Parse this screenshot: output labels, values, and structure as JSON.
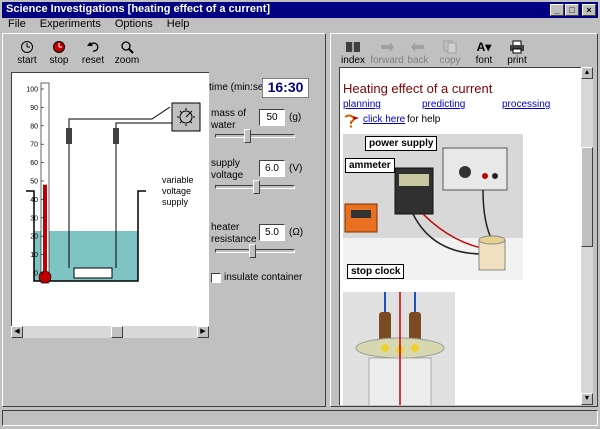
{
  "window": {
    "title": "Science Investigations [heating effect of a current]"
  },
  "menu": [
    "File",
    "Experiments",
    "Options",
    "Help"
  ],
  "toolbar_left": [
    {
      "label": "start",
      "icon": "start-icon"
    },
    {
      "label": "stop",
      "icon": "stop-icon"
    },
    {
      "label": "reset",
      "icon": "reset-icon"
    },
    {
      "label": "zoom",
      "icon": "zoom-icon"
    }
  ],
  "toolbar_right": [
    {
      "label": "index",
      "icon": "index-icon"
    },
    {
      "label": "forward",
      "icon": "forward-icon"
    },
    {
      "label": "back",
      "icon": "back-icon"
    },
    {
      "label": "copy",
      "icon": "copy-icon"
    },
    {
      "label": "font",
      "icon": "font-icon"
    },
    {
      "label": "print",
      "icon": "print-icon"
    }
  ],
  "thermometer": {
    "scale": [
      "100",
      "90",
      "80",
      "70",
      "60",
      "50",
      "40",
      "30",
      "20",
      "10",
      "0"
    ],
    "reading": 48
  },
  "supply_label": "variable voltage supply",
  "controls": {
    "time_label": "time (min:sec)",
    "time_value": "16:30",
    "mass_label": "mass of water",
    "mass_value": "50",
    "mass_unit": "(g)",
    "voltage_label": "supply voltage",
    "voltage_value": "6.0",
    "voltage_unit": "(V)",
    "resistance_label": "heater resistance",
    "resistance_value": "5.0",
    "resistance_unit": "(Ω)",
    "insulate_label": "insulate container",
    "insulate_checked": false
  },
  "help": {
    "heading": "Heating effect of a current",
    "links": [
      "planning",
      "predicting",
      "processing"
    ],
    "click_here": "click here",
    "for_help": "for help",
    "photo_labels": {
      "power_supply": "power supply",
      "ammeter": "ammeter",
      "stop_clock": "stop clock"
    }
  },
  "colors": {
    "title_bar": "#000080",
    "heading": "#800000",
    "time_value": "#000080",
    "water": "#7fc4c4",
    "link": "#0000cc"
  }
}
